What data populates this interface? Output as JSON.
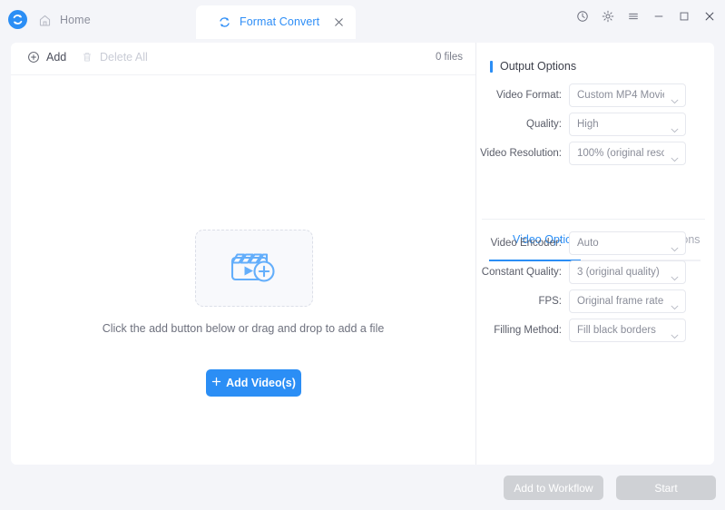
{
  "titlebar": {
    "logo_icon": "app-logo-icon",
    "home_label": "Home",
    "home_icon": "home-icon",
    "tab": {
      "label": "Format Convert",
      "icon": "sync-refresh-icon",
      "close_icon": "close-icon"
    },
    "window_controls": [
      {
        "name": "history-clock-icon",
        "glyph": "clock"
      },
      {
        "name": "settings-gear-icon",
        "glyph": "gear"
      },
      {
        "name": "menu-hamburger-icon",
        "glyph": "menu"
      },
      {
        "name": "minimize-icon",
        "glyph": "minimize"
      },
      {
        "name": "maximize-icon",
        "glyph": "maximize"
      },
      {
        "name": "close-window-icon",
        "glyph": "close"
      }
    ]
  },
  "filelist": {
    "add_label": "Add",
    "add_icon": "plus-circle-icon",
    "delete_all_label": "Delete All",
    "delete_all_icon": "trash-icon",
    "files_count": "0 files",
    "empty_hint": "Click the add button below or drag and drop to add a file",
    "add_video_button": "Add Video(s)",
    "dropzone_icon": "clapperboard-add-icon"
  },
  "output_options": {
    "title": "Output Options",
    "fields": [
      {
        "label": "Video Format:",
        "value": "Custom MP4 Movie(...",
        "name": "video-format-select"
      },
      {
        "label": "Quality:",
        "value": "High",
        "name": "quality-select"
      },
      {
        "label": "Video Resolution:",
        "value": "100% (original resol...",
        "name": "video-resolution-select"
      }
    ]
  },
  "option_tabs": {
    "video_label": "Video Options",
    "audio_label": "Audio Options",
    "active": "Video Options"
  },
  "video_options": {
    "fields": [
      {
        "label": "Video Encoder:",
        "value": "Auto",
        "name": "video-encoder-select"
      },
      {
        "label": "Constant Quality:",
        "value": "3 (original quality)",
        "name": "constant-quality-select"
      },
      {
        "label": "FPS:",
        "value": "Original frame rate",
        "name": "fps-select"
      },
      {
        "label": "Filling Method:",
        "value": "Fill black borders",
        "name": "filling-method-select"
      }
    ]
  },
  "footer": {
    "add_to_workflow_label": "Add to Workflow",
    "start_label": "Start"
  },
  "colors": {
    "accent": "#2b8ef5",
    "background": "#f4f5f9",
    "card": "#ffffff",
    "disabled_button": "#cfd1d5",
    "muted_text": "#8a8d99"
  }
}
